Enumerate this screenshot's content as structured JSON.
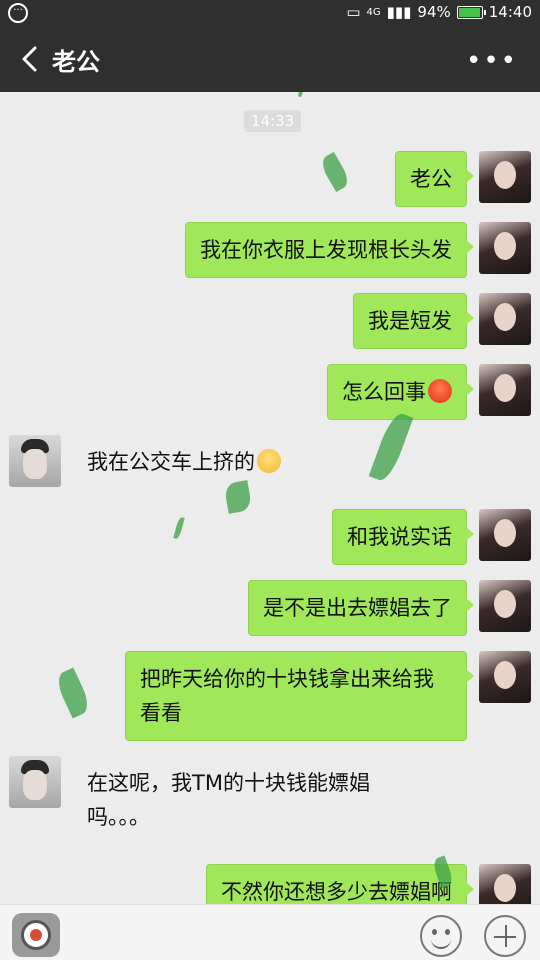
{
  "status_bar": {
    "battery": "94%",
    "time": "14:40",
    "network": "4G"
  },
  "header": {
    "title": "老公",
    "more": "•••"
  },
  "chat": {
    "timestamp": "14:33",
    "messages": [
      {
        "side": "out",
        "text": "老公"
      },
      {
        "side": "out",
        "text": "我在你衣服上发现根长头发"
      },
      {
        "side": "out",
        "text": "我是短发"
      },
      {
        "side": "out",
        "text": "怎么回事",
        "emoji": "angry-emoji"
      },
      {
        "side": "in",
        "text": "我在公交车上挤的",
        "emoji": "dizzy-emoji"
      },
      {
        "side": "out",
        "text": "和我说实话"
      },
      {
        "side": "out",
        "text": "是不是出去嫖娼去了"
      },
      {
        "side": "out",
        "text": "把昨天给你的十块钱拿出来给我看看"
      },
      {
        "side": "in",
        "text": "在这呢，我TM的十块钱能嫖娼吗。。。"
      },
      {
        "side": "out",
        "text": "不然你还想多少去嫖娼啊"
      }
    ]
  },
  "colors": {
    "header_bg": "#2f2f2f",
    "chat_bg": "#ececec",
    "outgoing_bubble": "#a0e75a"
  }
}
